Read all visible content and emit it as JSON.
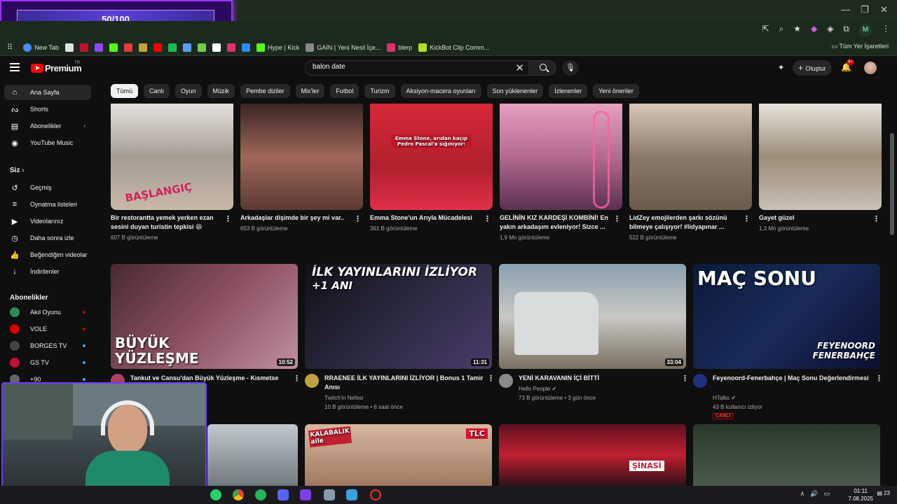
{
  "overlay": {
    "progress_text": "50/100",
    "progress": 0.5
  },
  "browser": {
    "profile_initial": "M",
    "bookmarks": [
      {
        "label": "New Tab",
        "color": "#4a8cff"
      },
      {
        "label": "",
        "color": "#e0e0e0"
      },
      {
        "label": "",
        "color": "#c4102e"
      },
      {
        "label": "",
        "color": "#9146ff"
      },
      {
        "label": "",
        "color": "#53fc18"
      },
      {
        "label": "",
        "color": "#e83a3a"
      },
      {
        "label": "",
        "color": "#c9a03a"
      },
      {
        "label": "",
        "color": "#ff0000"
      },
      {
        "label": "",
        "color": "#1db954"
      },
      {
        "label": "",
        "color": "#5b9bff"
      },
      {
        "label": "",
        "color": "#6fcf4f"
      },
      {
        "label": "",
        "color": "#ffffff"
      },
      {
        "label": "",
        "color": "#e1306c"
      },
      {
        "label": "",
        "color": "#2a8cff"
      },
      {
        "label": "Hype | Kick",
        "color": "#53fc18"
      },
      {
        "label": "GAİN | Yeni Nesil İçe...",
        "color": "#888888"
      },
      {
        "label": "blerp",
        "color": "#e0306c"
      },
      {
        "label": "KickBot Clip Comm...",
        "color": "#b0e020"
      }
    ],
    "bookmarks_right": "Tüm Yer İşaretleri"
  },
  "youtube": {
    "brand": "Premium",
    "brand_sup": "TR",
    "search": {
      "value": "balon date"
    },
    "create_label": "Oluştur",
    "notif_count": "9+",
    "chips": [
      "Tümü",
      "Canlı",
      "Oyun",
      "Müzik",
      "Pembe diziler",
      "Mix'ler",
      "Futbol",
      "Turizm",
      "Aksiyon-macera oyunları",
      "Son yüklenenler",
      "İzlenenler",
      "Yeni öneriler"
    ],
    "sidebar": {
      "main": [
        {
          "label": "Ana Sayfa",
          "icon": "home-icon"
        },
        {
          "label": "Shorts",
          "icon": "shorts-icon"
        },
        {
          "label": "Abonelikler",
          "icon": "subscriptions-icon"
        },
        {
          "label": "YouTube Music",
          "icon": "music-icon"
        }
      ],
      "you_label": "Siz",
      "you": [
        {
          "label": "Geçmiş",
          "icon": "history-icon"
        },
        {
          "label": "Oynatma listeleri",
          "icon": "playlist-icon"
        },
        {
          "label": "Videolarınız",
          "icon": "video-icon"
        },
        {
          "label": "Daha sonra izle",
          "icon": "clock-icon"
        },
        {
          "label": "Beğendiğim videolar",
          "icon": "like-icon"
        },
        {
          "label": "İndirilenler",
          "icon": "download-icon"
        }
      ],
      "subs_label": "Abonelikler",
      "subs": [
        {
          "label": "Akıl Oyunu",
          "color": "#2e8b57",
          "dot": "#cc0000"
        },
        {
          "label": "VOLE",
          "color": "#d40000",
          "dot": "#cc0000"
        },
        {
          "label": "BORGES TV",
          "color": "#444444",
          "dot": "#3ea6ff"
        },
        {
          "label": "GS TV",
          "color": "#c4102e",
          "dot": "#3ea6ff"
        },
        {
          "label": "+90",
          "color": "#666666",
          "dot": "#3ea6ff"
        }
      ]
    },
    "shorts_row": [
      {
        "title": "Bir restorantta yemek yerken ezan sesini duyan turistin tepkisi 😆",
        "views": "607 B görüntüleme",
        "thumb_text": "BAŞLANGIÇ"
      },
      {
        "title": "Arkadaşlar dişimde bir şey mi var..",
        "views": "653 B görüntüleme",
        "thumb_text": ""
      },
      {
        "title": "Emma Stone'un Arıyla Mücadelesi",
        "views": "361 B görüntüleme",
        "thumb_text": "Emma Stone, arıdan kaçıp Pedro Pascal'a sığınıyor:"
      },
      {
        "title": "GELİNİN KIZ KARDEŞİ KOMBİNİ! En yakın arkadaşım evleniyor! Sizce ...",
        "views": "1,9 Mn görüntüleme",
        "thumb_text": ""
      },
      {
        "title": "LidZey emojilerden şarkı sözünü bilmeye çalışıyor! #lidyapınar ...",
        "views": "522 B görüntüleme",
        "thumb_text": ""
      },
      {
        "title": "Gayet güzel",
        "views": "1,3 Mn görüntüleme",
        "thumb_text": ""
      }
    ],
    "videos_row": [
      {
        "title": "Tankut ve Cansu'dan Büyük Yüzleşme - Kısmetse Olur: Aşkın Gücü",
        "channel": "",
        "meta": "",
        "duration": "10:52",
        "thumb_text": "BÜYÜK YÜZLEŞME",
        "live": ""
      },
      {
        "title": "RRAENEE İLK YAYINLARINI İZLİYOR | Bonus 1 Tamir Anısı",
        "channel": "Twitch'in Nefesi",
        "meta": "10 B görüntüleme • 6 saat önce",
        "duration": "11:31",
        "thumb_text": "İLK YAYINLARINI İZLİYOR",
        "thumb_text2": "+1 ANI",
        "live": ""
      },
      {
        "title": "YENİ KARAVANIN İÇİ BİTTİ",
        "channel": "Hello People",
        "meta": "73 B görüntüleme • 3 gün önce",
        "duration": "33:04",
        "thumb_text": "",
        "live": ""
      },
      {
        "title": "Feyenoord-Fenerbahçe | Maç Sonu Değerlendirmesi",
        "channel": "HTalks",
        "meta": "43 B kullanıcı izliyor",
        "duration": "",
        "thumb_text": "MAÇ SONU",
        "thumb_text2": "FEYENOORD FENERBAHÇE",
        "live": "CANLI"
      }
    ],
    "bottom_row": [
      {
        "thumb_text": ""
      },
      {
        "thumb_text": "KALABALIK aile",
        "badge": "TLC"
      },
      {
        "thumb_text": "ŞİNASİ"
      },
      {
        "thumb_text": ""
      }
    ]
  },
  "taskbar": {
    "time": "01:11",
    "date": "7.08.2025",
    "notif": "23"
  }
}
